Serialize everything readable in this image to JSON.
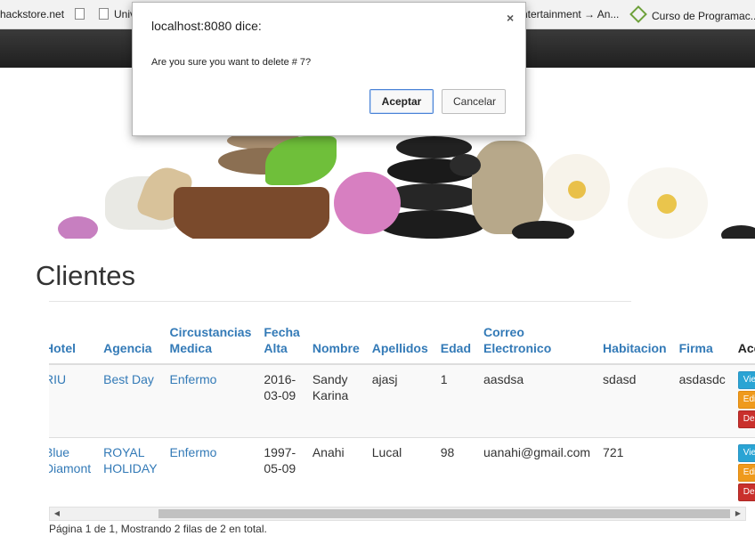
{
  "bookmarks": [
    {
      "label": "hackstore.net",
      "icon": "none"
    },
    {
      "label": "",
      "icon": "page-icon"
    },
    {
      "label": "Univ",
      "icon": "page-icon"
    },
    {
      "label": "ntertainment → An...",
      "icon": "none"
    },
    {
      "label": "Curso de Programac...",
      "icon": "diamond-icon"
    }
  ],
  "dialog": {
    "title": "localhost:8080 dice:",
    "close_label": "×",
    "message": "Are you sure you want to delete # 7?",
    "ok_label": "Aceptar",
    "cancel_label": "Cancelar"
  },
  "page": {
    "title": "Clientes"
  },
  "table": {
    "headers": [
      "Hotel",
      "Agencia",
      "Circustancias Medica",
      "Fecha Alta",
      "Nombre",
      "Apellidos",
      "Edad",
      "Correo Electronico",
      "Habitacion",
      "Firma",
      "Acciones"
    ],
    "rows": [
      {
        "hotel": "RIU",
        "agencia": "Best Day",
        "circunstancias": "Enfermo",
        "fecha": "2016-03-09",
        "nombre": "Sandy Karina",
        "apellidos": "ajasj",
        "edad": "1",
        "correo": "aasdsa",
        "habitacion": "sdasd",
        "firma": "asdasdc"
      },
      {
        "hotel": "Blue Diamont",
        "agencia": "ROYAL HOLIDAY",
        "circunstancias": "Enfermo",
        "fecha": "1997-05-09",
        "nombre": "Anahi",
        "apellidos": "Lucal",
        "edad": "98",
        "correo": "uanahi@gmail.com",
        "habitacion": "721",
        "firma": ""
      }
    ],
    "actions": {
      "view": "View",
      "edit": "Edit",
      "delete": "Delete"
    }
  },
  "pager": "Página 1 de 1, Mostrando 2 filas de 2 en total.",
  "scrollbar": {
    "left_arrow": "◀",
    "right_arrow": "▶"
  }
}
